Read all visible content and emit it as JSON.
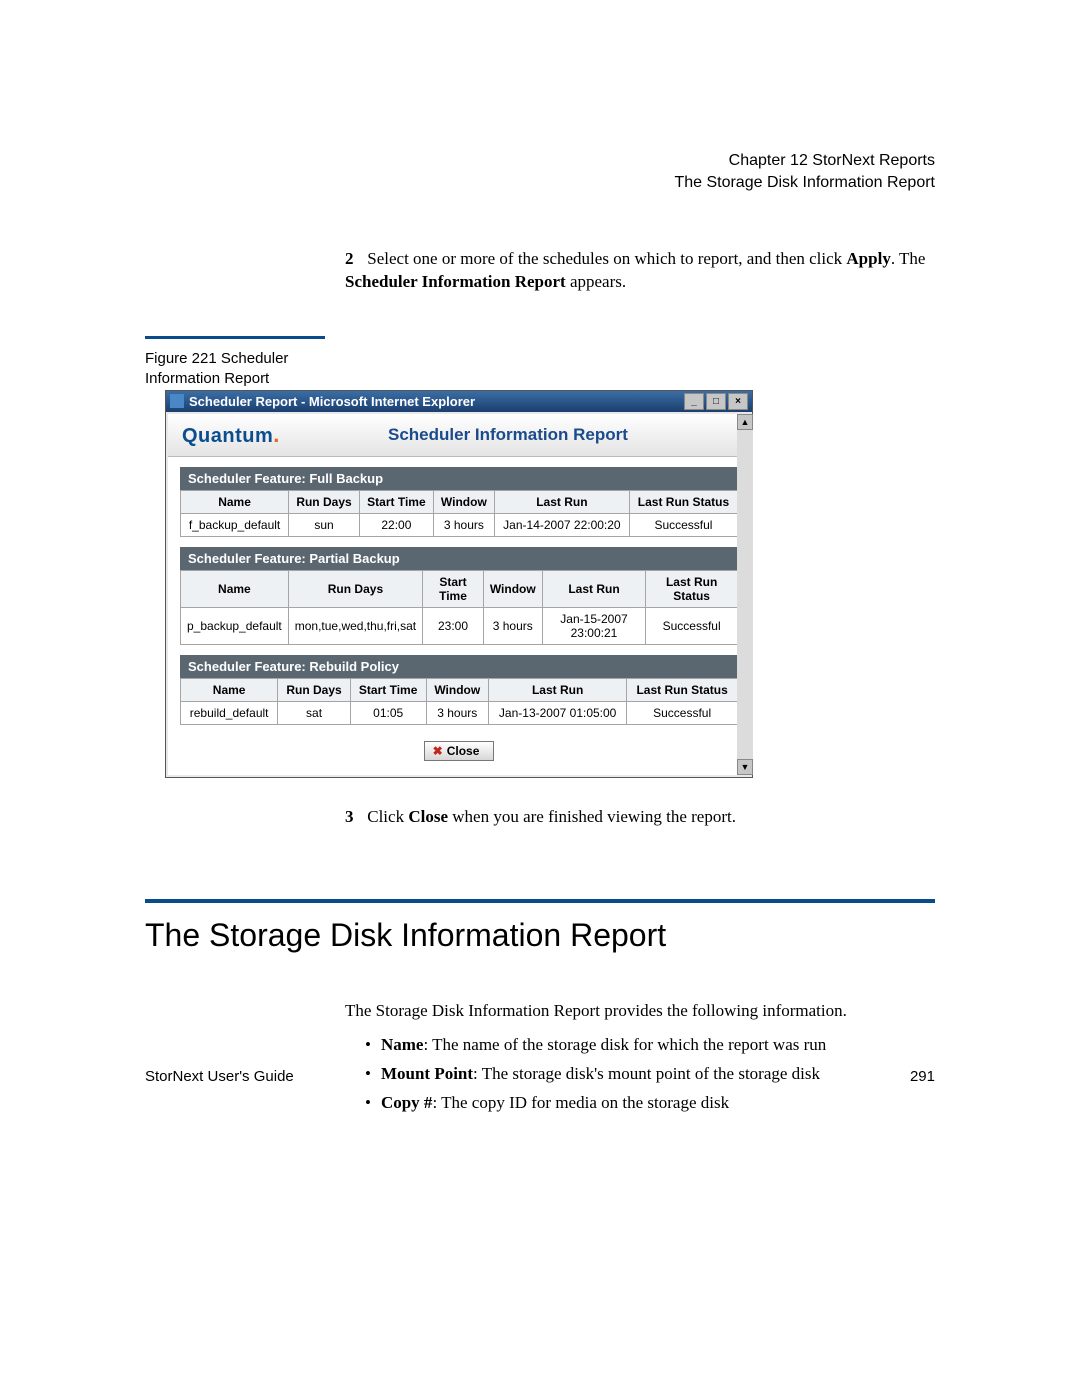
{
  "header": {
    "chapter": "Chapter 12  StorNext Reports",
    "section": "The Storage Disk Information Report"
  },
  "step2": {
    "num": "2",
    "text_before": "Select one or more of the schedules on which to report, and then click ",
    "bold1": "Apply",
    "mid": ". The ",
    "bold2": "Scheduler Information Report",
    "after": " appears."
  },
  "figure": {
    "caption": "Figure 221  Scheduler Information Report",
    "window_title": "Scheduler Report - Microsoft Internet Explorer",
    "brand": "Quantum",
    "report_title": "Scheduler Information Report",
    "close_label": "Close",
    "features": [
      {
        "title": "Scheduler Feature: Full Backup",
        "headers": [
          "Name",
          "Run Days",
          "Start Time",
          "Window",
          "Last Run",
          "Last Run Status"
        ],
        "rows": [
          [
            "f_backup_default",
            "sun",
            "22:00",
            "3 hours",
            "Jan-14-2007 22:00:20",
            "Successful"
          ]
        ]
      },
      {
        "title": "Scheduler Feature: Partial Backup",
        "headers": [
          "Name",
          "Run Days",
          "Start Time",
          "Window",
          "Last Run",
          "Last Run Status"
        ],
        "rows": [
          [
            "p_backup_default",
            "mon,tue,wed,thu,fri,sat",
            "23:00",
            "3 hours",
            "Jan-15-2007 23:00:21",
            "Successful"
          ]
        ]
      },
      {
        "title": "Scheduler Feature: Rebuild Policy",
        "headers": [
          "Name",
          "Run Days",
          "Start Time",
          "Window",
          "Last Run",
          "Last Run Status"
        ],
        "rows": [
          [
            "rebuild_default",
            "sat",
            "01:05",
            "3 hours",
            "Jan-13-2007 01:05:00",
            "Successful"
          ]
        ]
      }
    ]
  },
  "step3": {
    "num": "3",
    "before": "Click ",
    "bold": "Close",
    "after": " when you are finished viewing the report."
  },
  "section": {
    "title": "The Storage Disk Information Report",
    "intro": "The Storage Disk Information Report provides the following information.",
    "bullets": [
      {
        "b": "Name",
        "rest": ": The name of the storage disk for which the report was run"
      },
      {
        "b": "Mount Point",
        "rest": ": The storage disk's mount point of the storage disk"
      },
      {
        "b": "Copy #",
        "rest": ": The copy ID for media on the storage disk"
      }
    ]
  },
  "footer": {
    "left": "StorNext User's Guide",
    "right": "291"
  }
}
